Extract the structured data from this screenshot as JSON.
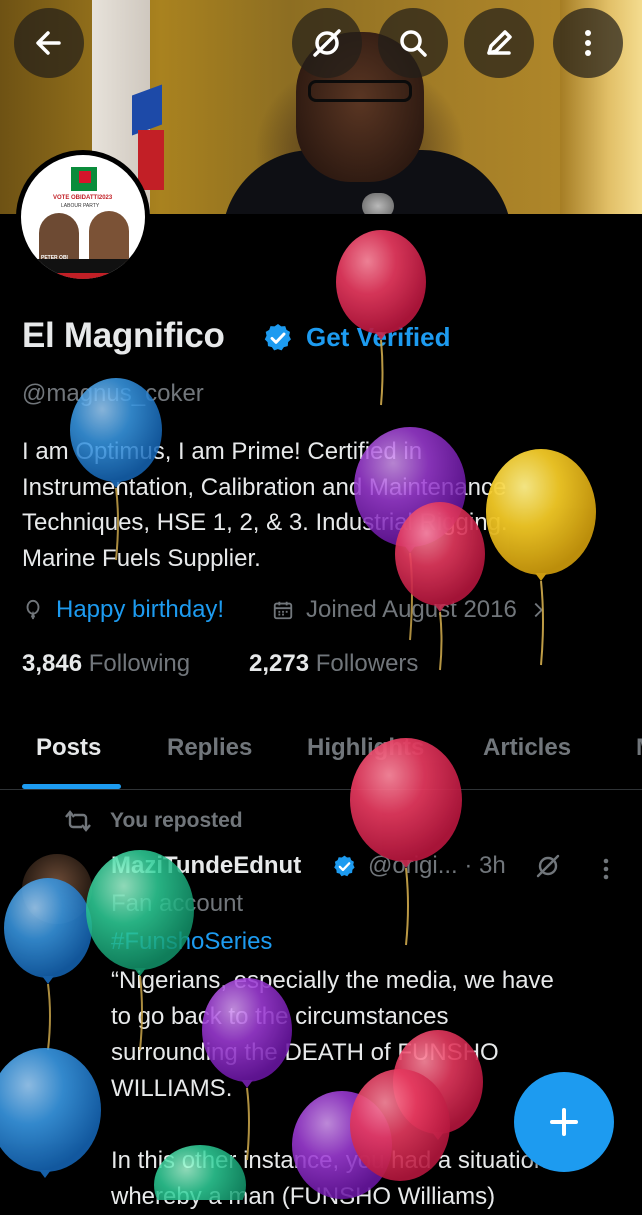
{
  "header": {
    "back_icon": "arrow-left-icon",
    "grok_icon": "grok-icon",
    "search_icon": "search-icon",
    "edit_icon": "edit-pen-icon",
    "more_icon": "more-vertical-icon"
  },
  "profile": {
    "name": "El Magnifico",
    "get_verified": "Get Verified",
    "handle": "@magnus_coker",
    "bio": "I am Optimus, I am Prime! Certified in\nInstrumentation, Calibration and Maintenance\nTechniques, HSE 1, 2, & 3. Industrial Rigging.\nMarine Fuels Supplier.",
    "birthday": "Happy birthday!",
    "joined": "Joined August 2016",
    "following_count": "3,846",
    "following_label": "Following",
    "followers_count": "2,273",
    "followers_label": "Followers",
    "avatar_text": {
      "top": "VOTE OBIDATTI2023",
      "sub": "LABOUR PARTY",
      "left": "PETER OBI",
      "left_role": "FOR PRESIDENT",
      "bottom": "WE ARE THE STRUCTURE"
    }
  },
  "tabs": [
    {
      "label": "Posts",
      "active": true
    },
    {
      "label": "Replies",
      "active": false
    },
    {
      "label": "Highlights",
      "active": false
    },
    {
      "label": "Articles",
      "active": false
    }
  ],
  "post": {
    "repost_label": "You reposted",
    "author_name": "MaziTundeEdnut",
    "author_handle": "@origi...",
    "time": "· 3h",
    "subtitle": "Fan account",
    "hashtag": "#FunshoSeries",
    "text": "“Nigerians, especially the media, we have\nto go back to the circumstances\nsurrounding the DEATH of FUNSHO\nWILLIAMS.\n\nIn this other instance, you had a situation\nwhereby a man (FUNSHO Williams)"
  },
  "fab_icon": "plus-icon",
  "colors": {
    "accent": "#1d9bf0",
    "text": "#e7e9ea",
    "muted": "#71767b",
    "background": "#000000"
  }
}
